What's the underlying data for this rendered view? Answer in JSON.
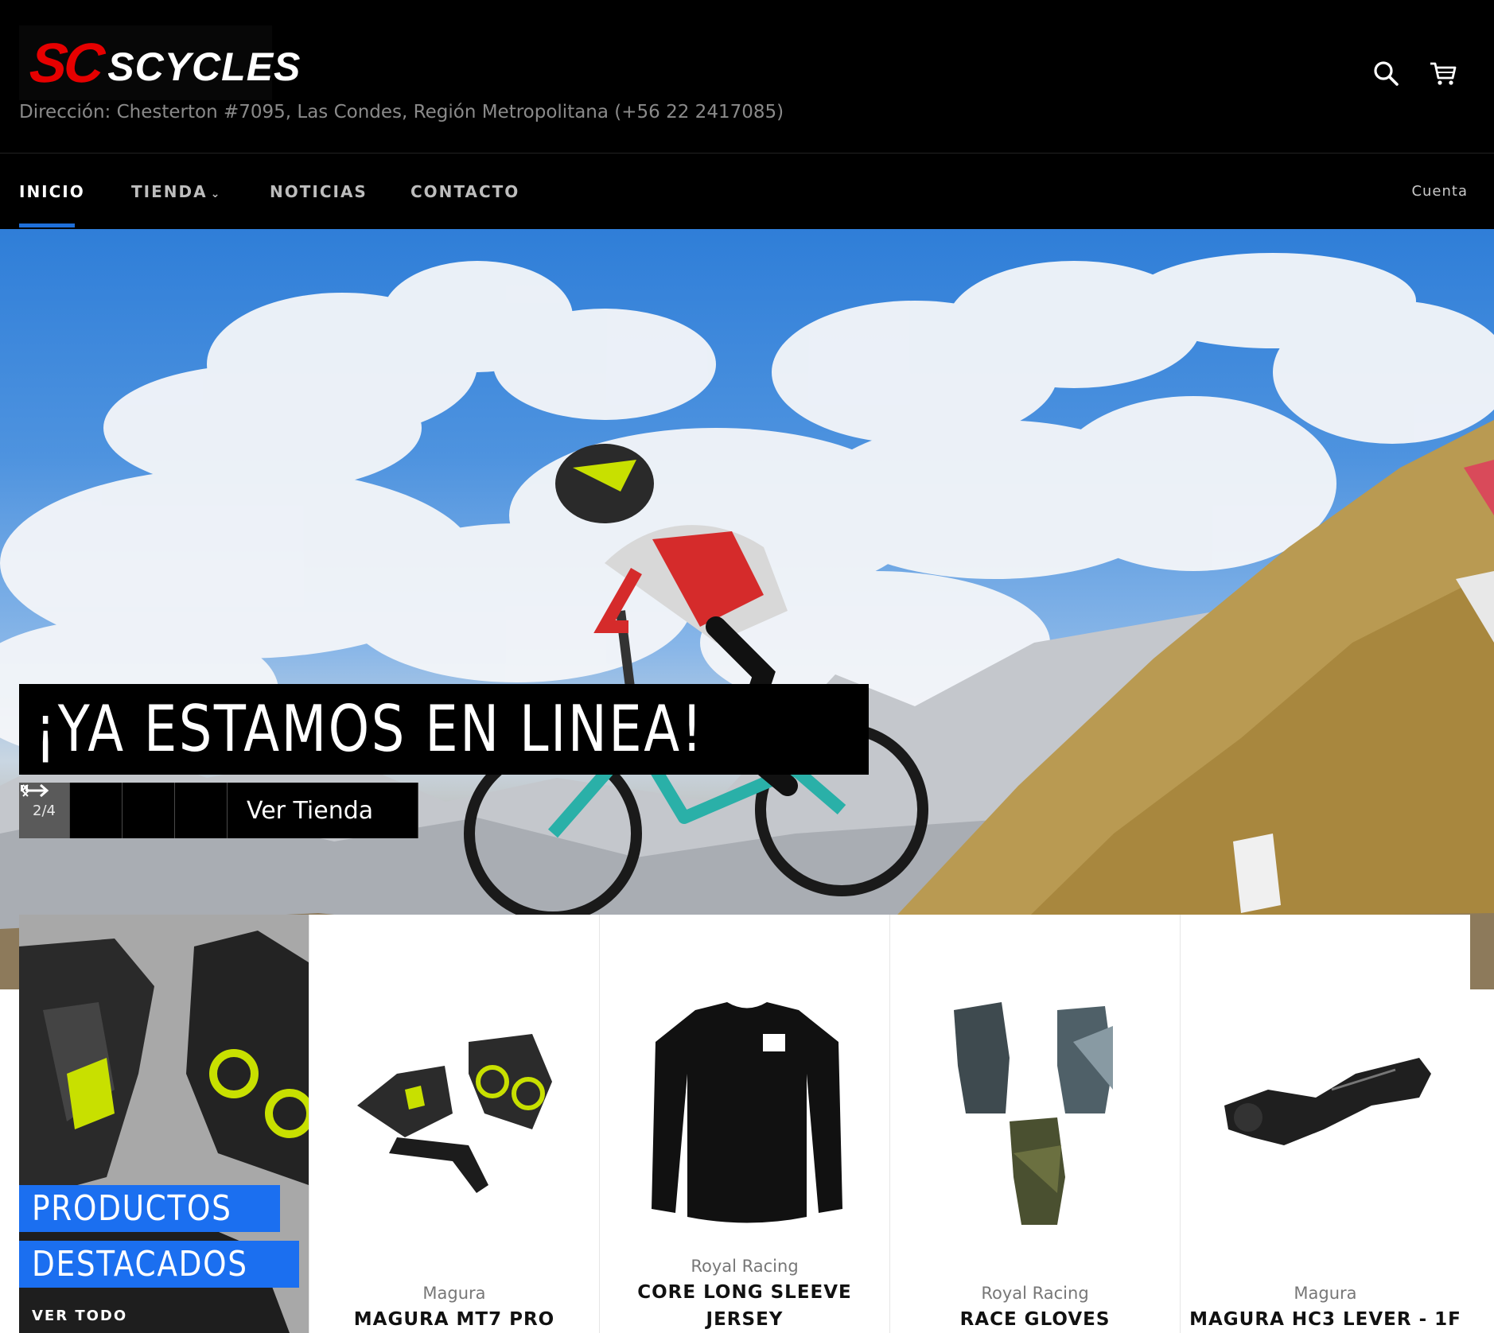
{
  "header": {
    "logo_sc": "SC",
    "logo_cycles": "SCYCLES",
    "address": "Dirección: Chesterton #7095, Las Condes, Región Metropolitana (+56 22 2417085)",
    "icons": [
      "search-icon",
      "cart-icon"
    ]
  },
  "nav": {
    "items": [
      {
        "label": "INICIO",
        "active": true
      },
      {
        "label": "TIENDA",
        "has_dropdown": true
      },
      {
        "label": "NOTICIAS"
      },
      {
        "label": "CONTACTO"
      }
    ],
    "account": "Cuenta",
    "accent_color": "#1e6fd9"
  },
  "hero": {
    "title": "¡YA ESTAMOS EN LINEA!",
    "slide_counter": "2/4",
    "pause_icon": "pause-icon",
    "prev_icon": "chevron-left-icon",
    "next_icon": "chevron-right-icon",
    "cta_label": "Ver Tienda",
    "cta_icon": "arrow-right-icon"
  },
  "featured": {
    "line1": "PRODUCTOS",
    "line2": "DESTACADOS",
    "view_all": "VER TODO",
    "label_color": "#1b6ff0",
    "products": [
      {
        "vendor": "Magura",
        "title": "MAGURA MT7 PRO"
      },
      {
        "vendor": "Royal Racing",
        "title_line1": "CORE LONG SLEEVE",
        "title_line2": "JERSEY"
      },
      {
        "vendor": "Royal Racing",
        "title": "RACE GLOVES"
      },
      {
        "vendor": "Magura",
        "title": "MAGURA HC3 LEVER - 1F"
      }
    ]
  }
}
